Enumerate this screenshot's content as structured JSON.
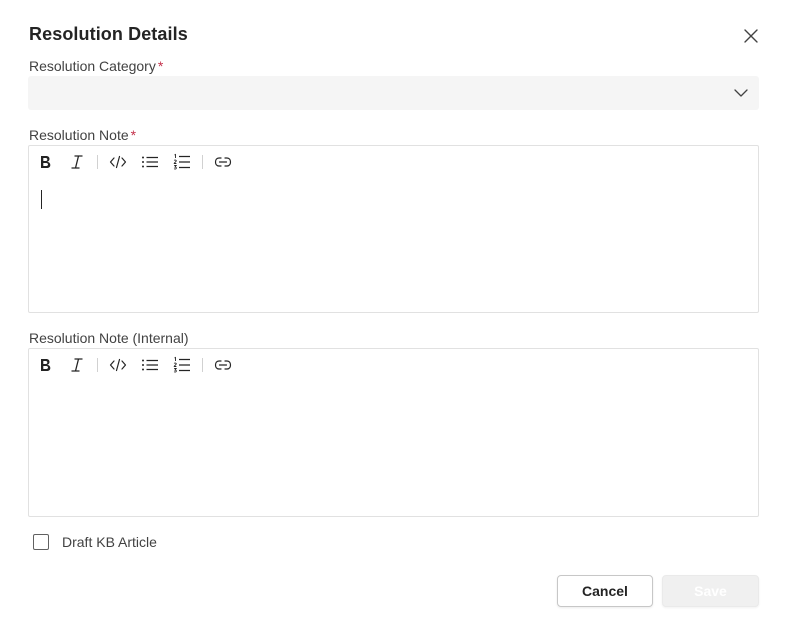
{
  "dialog": {
    "title": "Resolution Details",
    "close_icon": "close-icon"
  },
  "category": {
    "label": "Resolution Category",
    "required_marker": "*",
    "value": "",
    "icon": "chevron-down-icon"
  },
  "note": {
    "label": "Resolution Note",
    "required_marker": "*",
    "value": ""
  },
  "internal_note": {
    "label": "Resolution Note (Internal)",
    "value": ""
  },
  "toolbar_icons": [
    "bold-icon",
    "italic-icon",
    "code-icon",
    "bulleted-list-icon",
    "numbered-list-icon",
    "link-icon"
  ],
  "draft_kb": {
    "label": "Draft KB Article",
    "checked": false
  },
  "actions": {
    "cancel_label": "Cancel",
    "save_label": "Save",
    "save_disabled": true
  },
  "colors": {
    "required": "#c4314b",
    "text": "#242424",
    "input_bg": "#f5f5f5"
  }
}
